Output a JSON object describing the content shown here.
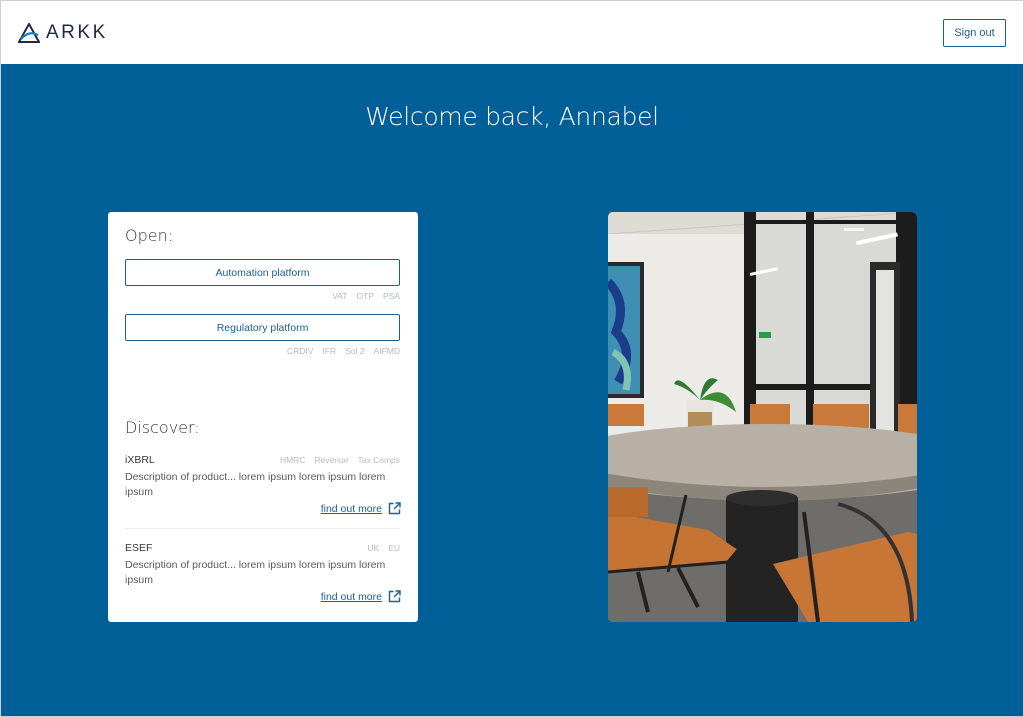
{
  "header": {
    "brand": "ARKK",
    "sign_out_label": "Sign out"
  },
  "main": {
    "welcome": "Welcome back, Annabel"
  },
  "open": {
    "title": "Open:",
    "items": [
      {
        "label": "Automation platform",
        "tags": [
          "VAT",
          "OTP",
          "PSA"
        ]
      },
      {
        "label": "Regulatory platform",
        "tags": [
          "CRDIV",
          "IFR",
          "Sol 2",
          "AIFMD"
        ]
      }
    ]
  },
  "discover": {
    "title": "Discover:",
    "products": [
      {
        "name": "iXBRL",
        "tags": [
          "HMRC",
          "Revenue",
          "Tax Comps"
        ],
        "description": "Description of product... lorem ipsum lorem ipsum lorem ipsum",
        "link": "find out more"
      },
      {
        "name": "ESEF",
        "tags": [
          "UK",
          "EU"
        ],
        "description": "Description of product... lorem ipsum lorem ipsum lorem ipsum",
        "link": "find out more"
      }
    ]
  },
  "colors": {
    "primary": "#005f96",
    "accent": "#1a5f97",
    "tag_text": "#b4b9c0"
  },
  "icons": {
    "logo": "arkk-logo-icon",
    "external": "external-link-icon"
  }
}
